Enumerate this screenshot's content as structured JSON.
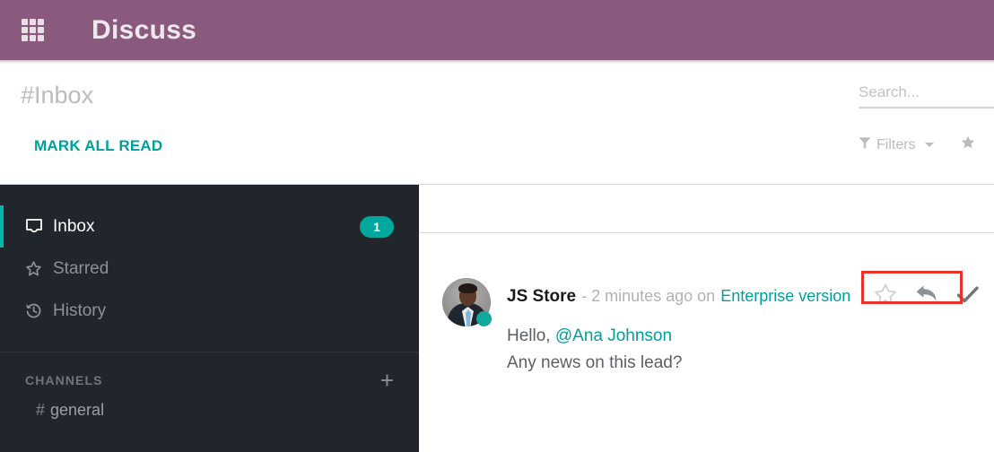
{
  "appbar": {
    "apps_icon": "grid-apps-icon",
    "title": "Discuss"
  },
  "control_panel": {
    "breadcrumb": "#Inbox",
    "mark_all_read_label": "MARK ALL READ",
    "search": {
      "placeholder": "Search...",
      "value": ""
    },
    "filters_label": "Filters",
    "favorites_label": ""
  },
  "sidebar": {
    "mailboxes": [
      {
        "label": "Inbox",
        "icon": "inbox-icon",
        "badge": "1",
        "active": true
      },
      {
        "label": "Starred",
        "icon": "star-icon",
        "badge": "",
        "active": false
      },
      {
        "label": "History",
        "icon": "history-icon",
        "badge": "",
        "active": false
      }
    ],
    "channels_header": "CHANNELS",
    "add_channel_label": "+",
    "channels": [
      {
        "hash": "#",
        "label": "general"
      }
    ]
  },
  "thread": {
    "message": {
      "author": "JS Store",
      "meta": "- 2 minutes ago on",
      "document_link": "Enterprise version",
      "lines": [
        {
          "prefix": "Hello, ",
          "mention": "@Ana Johnson"
        },
        {
          "prefix": "Any news on this lead?",
          "mention": ""
        }
      ],
      "actions": [
        {
          "name": "star-toggle",
          "icon": "star-outline-icon"
        },
        {
          "name": "reply-button",
          "icon": "reply-arrow-icon"
        },
        {
          "name": "mark-read-button",
          "icon": "check-icon"
        }
      ]
    }
  },
  "colors": {
    "appbar": "#8A5A7E",
    "accent_teal": "#00a09d",
    "sidebar_bg": "#21262c",
    "badge": "#00a79d",
    "highlight_red": "#e8332a"
  }
}
